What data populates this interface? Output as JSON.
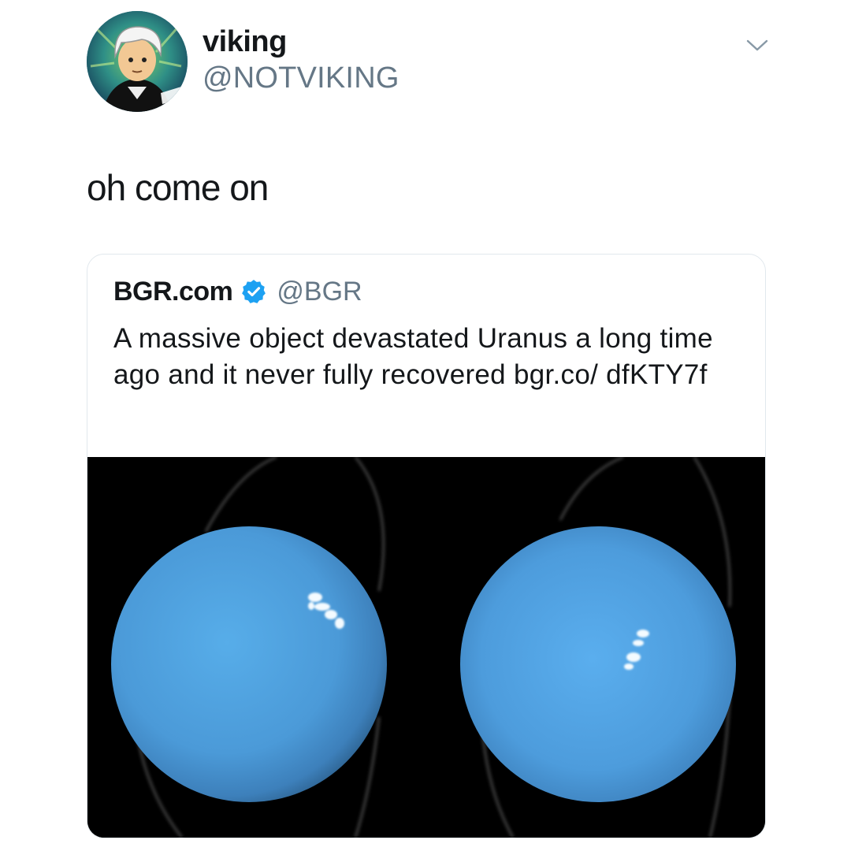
{
  "tweet": {
    "author": {
      "display_name": "viking",
      "handle": "@NOTVIKING"
    },
    "text": "oh come on",
    "menu_icon": "chevron-down-icon"
  },
  "quoted_tweet": {
    "author": {
      "display_name": "BGR.com",
      "handle": "@BGR",
      "verified": true,
      "verified_icon": "verified-badge-icon"
    },
    "text": "A massive object devastated Uranus a long time ago and it never fully recovered bgr.co/ dfKTY7f",
    "media": {
      "description_icon": "uranus-image"
    }
  },
  "colors": {
    "text_primary": "#14171a",
    "text_secondary": "#657786",
    "verified_blue": "#1da1f2",
    "card_border": "#e1e8ed",
    "planet_blue": "#4fa3e6"
  }
}
